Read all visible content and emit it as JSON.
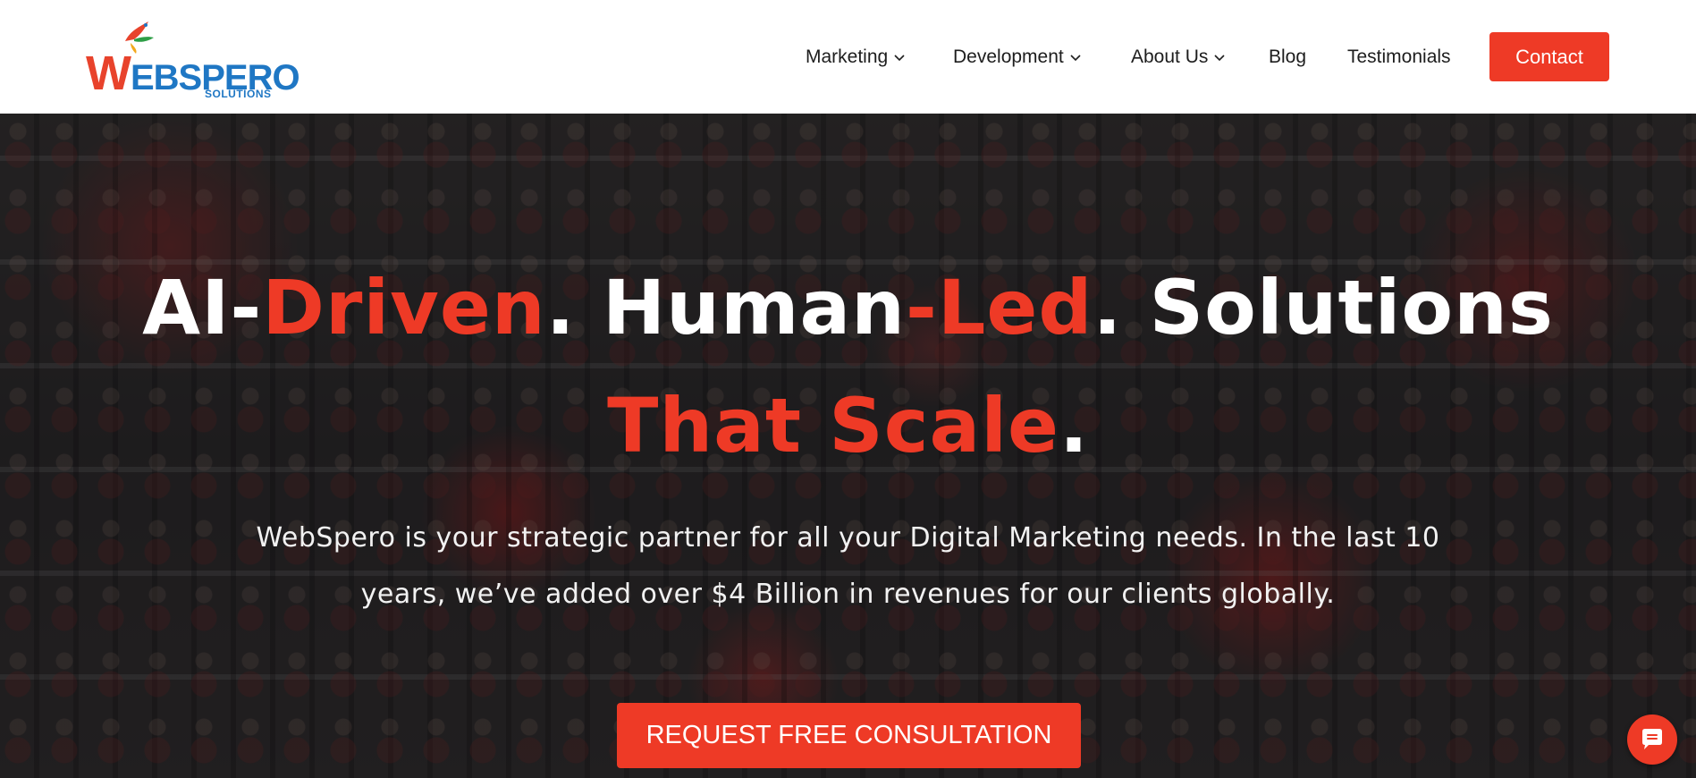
{
  "brand": {
    "logo_main": "WEBSPERO",
    "logo_first_letter": "W",
    "logo_rest": "EBSPERO",
    "logo_sub": "SOLUTIONS"
  },
  "nav": {
    "items": [
      {
        "label": "Marketing",
        "has_dropdown": true
      },
      {
        "label": "Development",
        "has_dropdown": true
      },
      {
        "label": "About Us",
        "has_dropdown": true
      },
      {
        "label": "Blog",
        "has_dropdown": false
      },
      {
        "label": "Testimonials",
        "has_dropdown": false
      }
    ],
    "contact_label": "Contact"
  },
  "hero": {
    "line1": {
      "part1": "AI-",
      "part2": "Driven",
      "part3": ". Human",
      "part4": "-Led",
      "part5": ". Solutions"
    },
    "line2": {
      "part1": "That Scale",
      "part2": "."
    },
    "subtext_line1": "WebSpero is your strategic partner for all your Digital Marketing needs. In the last 10",
    "subtext_line2": "years, we’ve added over $4 Billion in revenues for our clients globally.",
    "cta_label": "REQUEST FREE CONSULTATION"
  },
  "colors": {
    "accent": "#ee3a26",
    "brand_blue": "#1f77c4",
    "text_dark": "#1d1d1d",
    "white": "#ffffff"
  },
  "icons": {
    "chevron": "chevron-down-icon",
    "chat": "chat-bubble-icon",
    "logo_bird": "hummingbird-logo-icon"
  }
}
